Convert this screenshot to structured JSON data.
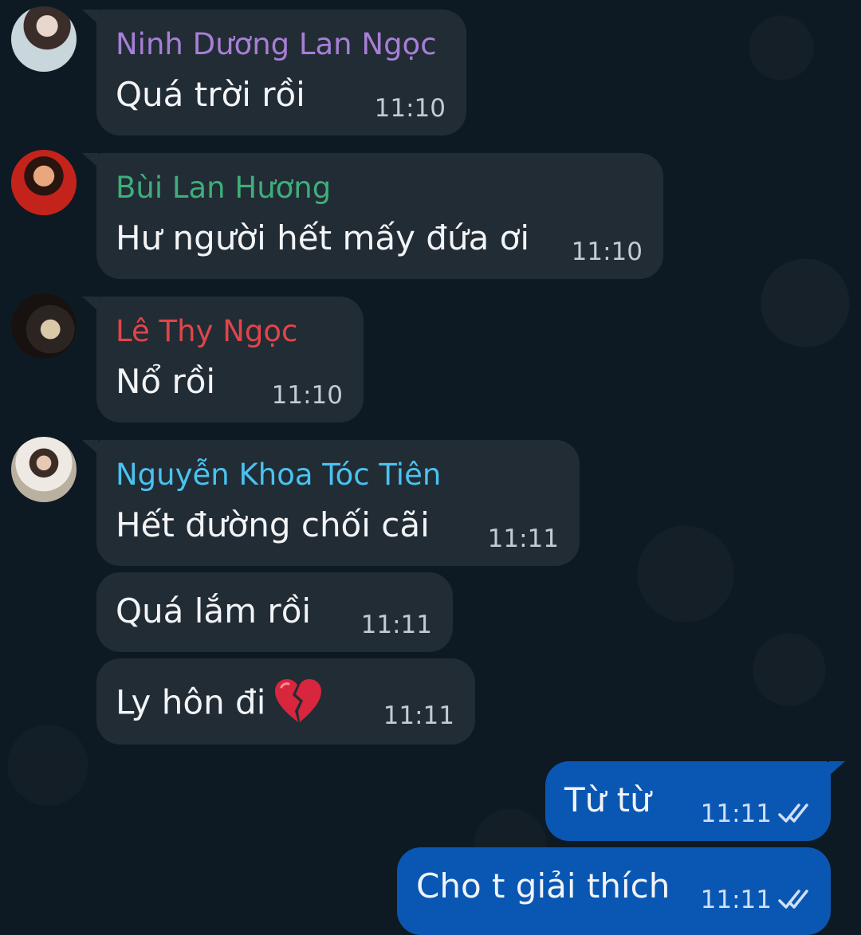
{
  "messages": [
    {
      "sender": "Ninh Dương Lan Ngọc",
      "sender_color": "#a77fd6",
      "text": "Quá trời rồi",
      "time": "11:10"
    },
    {
      "sender": "Bùi Lan Hương",
      "sender_color": "#3fae7a",
      "text": "Hư người hết mấy đứa ơi",
      "time": "11:10"
    },
    {
      "sender": "Lê Thy Ngọc",
      "sender_color": "#e0454a",
      "text": "Nổ rồi",
      "time": "11:10"
    },
    {
      "sender": "Nguyễn Khoa Tóc Tiên",
      "sender_color": "#49c3f0",
      "text": "Hết đường chối cãi",
      "time": "11:11"
    },
    {
      "text": "Quá lắm rồi",
      "time": "11:11"
    },
    {
      "text": "Ly hôn đi",
      "emoji": "broken-heart-icon",
      "time": "11:11"
    },
    {
      "text": "Từ từ",
      "time": "11:11",
      "outgoing": true,
      "status": "read"
    },
    {
      "text": "Cho t giải thích",
      "time": "11:11",
      "outgoing": true,
      "status": "read"
    }
  ],
  "colors": {
    "background": "#0e1a23",
    "incoming_bubble": "#222c35",
    "outgoing_bubble": "#0a57b3"
  }
}
